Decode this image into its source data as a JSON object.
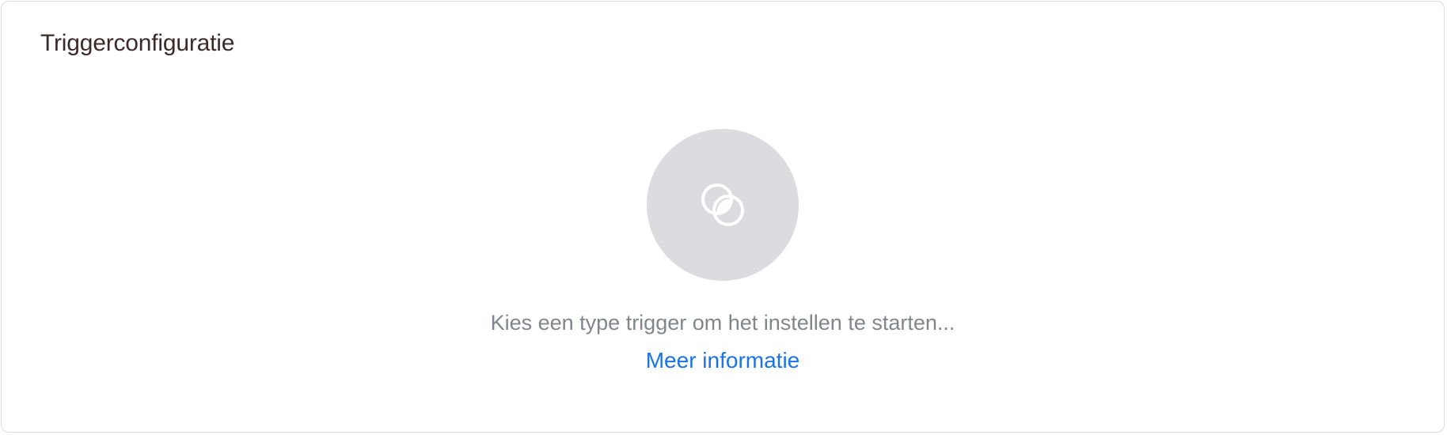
{
  "card": {
    "title": "Triggerconfiguratie"
  },
  "empty_state": {
    "icon": "trigger-circles-icon",
    "hint": "Kies een type trigger om het instellen te starten...",
    "link_label": "Meer informatie"
  },
  "colors": {
    "title": "#3c2a2a",
    "icon_bg": "#dadce0",
    "hint": "#80868b",
    "link": "#1a73e8",
    "border": "#dadce0"
  }
}
